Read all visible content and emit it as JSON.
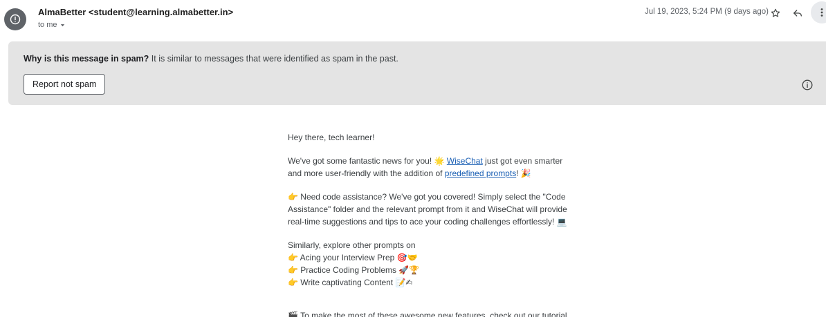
{
  "header": {
    "sender": "AlmaBetter <student@learning.almabetter.in>",
    "recipient": "to me",
    "date": "Jul 19, 2023, 5:24 PM (9 days ago)",
    "icons": [
      "info-icon",
      "star-icon",
      "reply-icon",
      "more-vert-icon"
    ]
  },
  "spam_banner": {
    "question": "Why is this message in spam?",
    "explanation": "It is similar to messages that were identified as spam in the past.",
    "button_label": "Report not spam"
  },
  "body": {
    "greeting": "Hey there, tech learner!",
    "p2_before": "We've got some fantastic news for you! ",
    "p2_emoji1": "🌟",
    "p2_link1": "WiseChat",
    "p2_mid1": " just got even smarter",
    "p2_line2_before": "and more user-friendly with the addition of ",
    "p2_link2": "predefined prompts",
    "p2_after": "! ",
    "p2_emoji2": "🎉",
    "p3_emoji1": "👉",
    "p3_line1": " Need code assistance? We've got you covered! Simply select the \"Code",
    "p3_line2": "Assistance\" folder and the relevant prompt from it and WiseChat will provide",
    "p3_line3": "real-time suggestions and tips to ace your coding challenges effortlessly! ",
    "p3_emoji2": "💻",
    "p4_intro": "Similarly, explore other prompts on",
    "prompt_items": [
      {
        "pointer": "👉",
        "text": " Acing your Interview Prep ",
        "emoji": "🎯🤝"
      },
      {
        "pointer": "👉",
        "text": " Practice Coding Problems ",
        "emoji": "🚀🏆"
      },
      {
        "pointer": "👉",
        "text": " Write captivating Content ",
        "emoji": "📝✍"
      }
    ],
    "last_emoji": "🎬",
    "last_line": " To make the most of these awesome new features, check out our tutorial"
  }
}
